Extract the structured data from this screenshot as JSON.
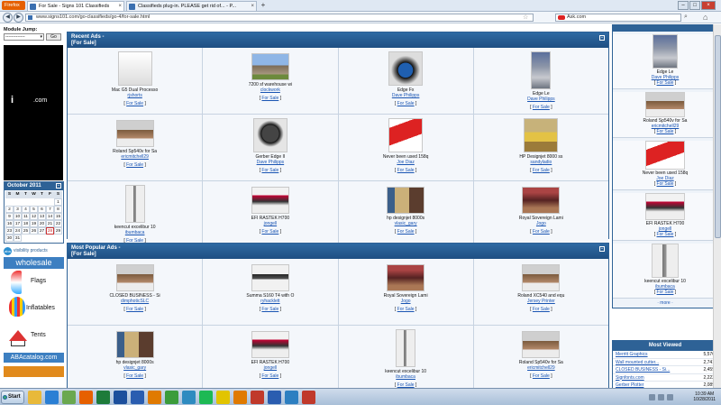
{
  "browser": {
    "app_button": "Firefox",
    "tabs": [
      {
        "label": "For Sale - Signs 101 Classifieds",
        "active": true
      },
      {
        "label": "Classifieds plug-in. PLEASE get rid of... - P...",
        "active": false
      }
    ],
    "url": "www.signs101.com/go-classifieds/go-4/for-sale.html",
    "search_engine": "Ask.com",
    "window_controls": [
      "–",
      "□",
      "×"
    ]
  },
  "module_jump": {
    "label": "Module Jump:",
    "select_value": "-------------",
    "go_label": "Go"
  },
  "black_ad": {
    "logo_i": "i",
    "logo_com": ".com"
  },
  "calendar": {
    "title": "October 2011",
    "day_headers": [
      "S",
      "M",
      "T",
      "W",
      "T",
      "F",
      "S"
    ],
    "weeks": [
      [
        "",
        "",
        "",
        "",
        "",
        "",
        "1"
      ],
      [
        "2",
        "3",
        "4",
        "5",
        "6",
        "7",
        "8"
      ],
      [
        "9",
        "10",
        "11",
        "12",
        "13",
        "14",
        "15"
      ],
      [
        "16",
        "17",
        "18",
        "19",
        "20",
        "21",
        "22"
      ],
      [
        "23",
        "24",
        "25",
        "26",
        "27",
        "28",
        "29"
      ],
      [
        "30",
        "31",
        "",
        "",
        "",
        "",
        ""
      ]
    ],
    "today": "28"
  },
  "left_ad": {
    "brand": "visibility products",
    "wholesale": "wholesale",
    "items": [
      "Flags",
      "Inflatables",
      "Tents"
    ],
    "catalog": "ABAcatalog.com"
  },
  "recent_ads": {
    "title_line1": "Recent Ads -",
    "title_line2": "[For Sale]",
    "category_link": "For Sale",
    "items": [
      {
        "title": "Mac G5 Dual Processo",
        "user": "rjshorts",
        "thumb": "doc"
      },
      {
        "title": "7200 sf warehouse wi",
        "user": "clockwork",
        "thumb": "building"
      },
      {
        "title": "Edge Fx",
        "user": "Dave Philipps",
        "thumb": "machine-blue"
      },
      {
        "title": "Edge Le",
        "user": "Dave Philipps",
        "thumb": "machine-gray"
      },
      {
        "title": "Roland Sp540v for Sa",
        "user": "ericmitchell29",
        "thumb": "printer-wide"
      },
      {
        "title": "Gerber Edge II",
        "user": "Dave Philipps",
        "thumb": "machine-dark"
      },
      {
        "title": "Never been used 158q",
        "user": "Joe Diaz",
        "thumb": "red-sign"
      },
      {
        "title": "HP Designjet 8000 ss",
        "user": "sandyladio",
        "thumb": "printer-yellow"
      },
      {
        "title": "keencut excelibur 10",
        "user": "ibumbaca",
        "thumb": "cutter"
      },
      {
        "title": "EFI RASTEK H700",
        "user": "jongell",
        "thumb": "printer-red"
      },
      {
        "title": "hp designjet 8000s",
        "user": "vlasic_gary",
        "thumb": "room"
      },
      {
        "title": "Royal Sovereign Lami",
        "user": "Jogo",
        "thumb": "laminator"
      }
    ]
  },
  "popular_ads": {
    "title_line1": "Most Popular Ads -",
    "title_line2": "[For Sale]",
    "category_link": "For Sale",
    "items": [
      {
        "title": "CLOSED BUSINESS - Si",
        "user": "dimphoticSLC",
        "thumb": "printer-wide"
      },
      {
        "title": "Summa S160 T4 with O",
        "user": "ryhacklett",
        "thumb": "plotter"
      },
      {
        "title": "Royal Sovereign Lami",
        "user": "Jogo",
        "thumb": "laminator"
      },
      {
        "title": "Roland XC540 and equ",
        "user": "Jersey Printer",
        "thumb": "printer-wide"
      },
      {
        "title": "hp designjet 8000s",
        "user": "vlasic_gary",
        "thumb": "room"
      },
      {
        "title": "EFI RASTEK H700",
        "user": "jongell",
        "thumb": "printer-red"
      },
      {
        "title": "keencut excelibur 10",
        "user": "ibumbaca",
        "thumb": "cutter"
      },
      {
        "title": "Roland Sp540v for Sa",
        "user": "ericmitchell29",
        "thumb": "printer-wide"
      }
    ]
  },
  "right_panel": {
    "category_link": "For Sale",
    "more_label": "more",
    "items": [
      {
        "title": "Edge Le",
        "user": "Dave Philipps",
        "thumb": "machine-gray"
      },
      {
        "title": "Roland Sp540v for Sa",
        "user": "ericmitchell29",
        "thumb": "printer-wide"
      },
      {
        "title": "Never been used 158q",
        "user": "Joe Diaz",
        "thumb": "red-sign"
      },
      {
        "title": "EFI RASTEK H700",
        "user": "jongell",
        "thumb": "printer-red"
      },
      {
        "title": "keencut excelibur 10",
        "user": "ibumbaca",
        "thumb": "cutter"
      }
    ]
  },
  "most_viewed": {
    "title": "Most Viewed",
    "rows": [
      {
        "name": "Merritt Graphics",
        "count": "5,576"
      },
      {
        "name": "Wall mounted cutter...",
        "count": "2,741"
      },
      {
        "name": "CLOSED BUSINESS - Si...",
        "count": "2,459"
      },
      {
        "name": "Signfonts.com",
        "count": "2,222"
      },
      {
        "name": "Gerber Plotter",
        "count": "2,089"
      }
    ]
  },
  "taskbar": {
    "start_label": "Start",
    "icons": [
      "folder",
      "ie",
      "notepad",
      "firefox",
      "excel",
      "photoshop",
      "ftp",
      "illustrator",
      "chrome",
      "tools",
      "spotify",
      "sync",
      "illustrator2",
      "pdf",
      "word",
      "network",
      "acrobat"
    ],
    "time": "10:39 AM",
    "date": "10/28/2011"
  }
}
